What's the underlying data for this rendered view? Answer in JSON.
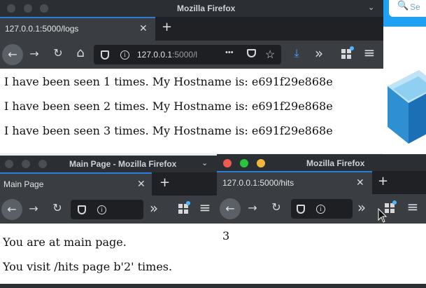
{
  "background_app": {
    "search_placeholder": "Se"
  },
  "window_logs": {
    "title": "Mozilla Firefox",
    "tab_label": "127.0.0.1:5000/logs",
    "url_host": "127.0.0.1",
    "url_rest": ":5000/l",
    "lines": [
      "I have been seen 1 times. My Hostname is: e691f29e868e",
      "I have been seen 2 times. My Hostname is: e691f29e868e",
      "I have been seen 3 times. My Hostname is: e691f29e868e"
    ]
  },
  "window_main": {
    "title": "Main Page - Mozilla Firefox",
    "tab_label": "Main Page",
    "lines": [
      "You are at main page.",
      "You visit /hits page b'2' times."
    ]
  },
  "window_hits": {
    "title": "Mozilla Firefox",
    "tab_label": "127.0.0.1:5000/hits",
    "content": "3"
  },
  "glyphs": {
    "close": "✕",
    "plus": "+",
    "back": "←",
    "forward": "→",
    "reload": "↻",
    "home": "⌂",
    "more": "•••",
    "star": "☆",
    "download": "⤓",
    "overflow": "»",
    "menu": "≡",
    "chevron": "⌄",
    "search": "🔍"
  }
}
